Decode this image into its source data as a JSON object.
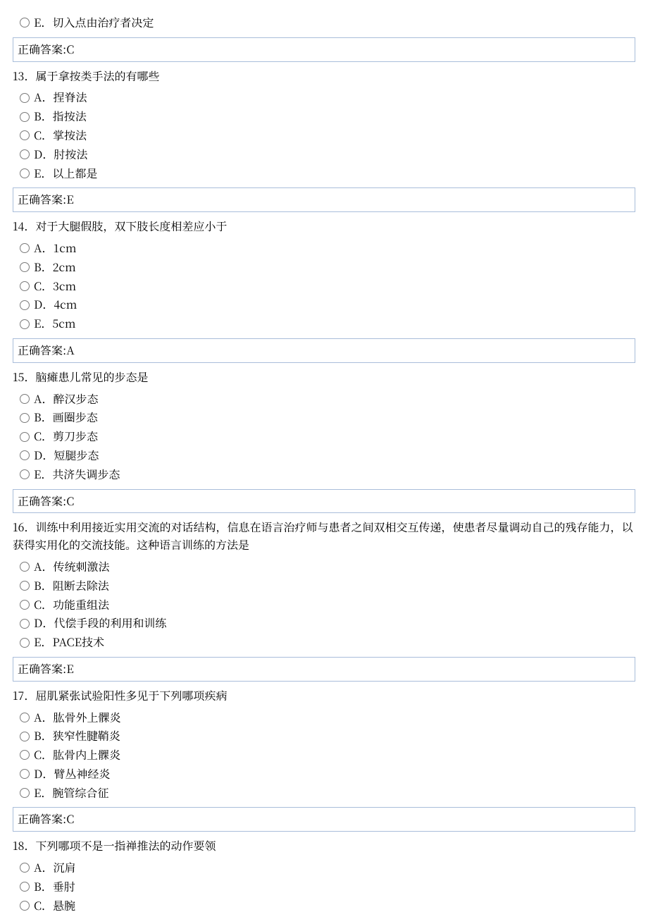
{
  "partial_top": {
    "option_e": "E．切入点由治疗者决定",
    "answer_label": "正确答案:",
    "answer_value": "C"
  },
  "questions": [
    {
      "stem": "13．属于拿按类手法的有哪些",
      "options": [
        "A．捏脊法",
        "B．指按法",
        "C．掌按法",
        "D．肘按法",
        "E．以上都是"
      ],
      "answer_label": "正确答案:",
      "answer_value": "E"
    },
    {
      "stem": "14．对于大腿假肢，双下肢长度相差应小于",
      "options": [
        "A．1cm",
        "B．2cm",
        "C．3cm",
        "D．4cm",
        "E．5cm"
      ],
      "answer_label": "正确答案:",
      "answer_value": "A"
    },
    {
      "stem": "15．脑瘫患儿常见的步态是",
      "options": [
        "A．醉汉步态",
        "B．画圈步态",
        "C．剪刀步态",
        "D．短腿步态",
        "E．共济失调步态"
      ],
      "answer_label": "正确答案:",
      "answer_value": "C"
    },
    {
      "stem": "16．训练中利用接近实用交流的对话结构，信息在语言治疗师与患者之间双相交互传递，使患者尽量调动自己的残存能力，以获得实用化的交流技能。这种语言训练的方法是",
      "options": [
        "A．传统刺激法",
        "B．阻断去除法",
        "C．功能重组法",
        "D．代偿手段的利用和训练",
        "E．PACE技术"
      ],
      "answer_label": "正确答案:",
      "answer_value": "E"
    },
    {
      "stem": "17．屈肌紧张试验阳性多见于下列哪项疾病",
      "options": [
        "A．肱骨外上髁炎",
        "B．狭窄性腱鞘炎",
        "C．肱骨内上髁炎",
        "D．臂丛神经炎",
        "E．腕管综合征"
      ],
      "answer_label": "正确答案:",
      "answer_value": "C"
    }
  ],
  "partial_bottom": {
    "stem": "18．下列哪项不是一指禅推法的动作要领",
    "options": [
      "A．沉肩",
      "B．垂肘",
      "C．悬腕"
    ]
  }
}
